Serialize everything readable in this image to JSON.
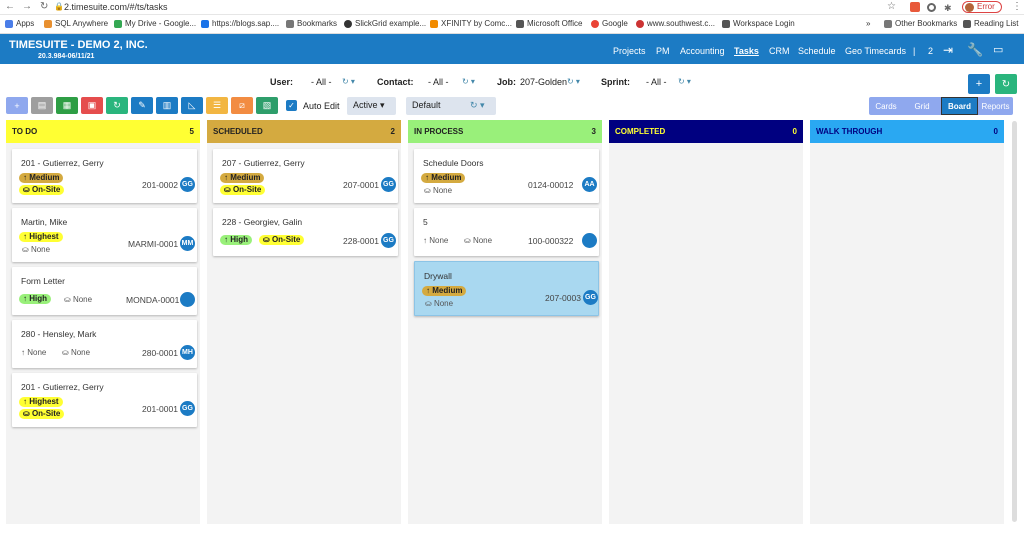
{
  "browser": {
    "url": "2.timesuite.com/#/ts/tasks",
    "error_label": "Error",
    "bookmarks": [
      "Apps",
      "SQL Anywhere",
      "My Drive - Google...",
      "https://blogs.sap....",
      "Bookmarks",
      "SlickGrid example...",
      "XFINITY by Comc...",
      "Microsoft Office",
      "Google",
      "www.southwest.c...",
      "Workspace Login"
    ],
    "other_bookmarks": "Other Bookmarks",
    "reading_list": "Reading List",
    "more": "»"
  },
  "app": {
    "title": "TIMESUITE - DEMO 2, INC.",
    "version": "20.3.984-06/11/21",
    "nav": [
      "Projects",
      "PM",
      "Accounting",
      "Tasks",
      "CRM",
      "Schedule",
      "Geo Timecards"
    ],
    "count": "2",
    "sep": "|"
  },
  "filters": {
    "user_label": "User:",
    "user_value": "- All -",
    "contact_label": "Contact:",
    "contact_value": "- All -",
    "job_label": "Job:",
    "job_value": "207-Golden",
    "sprint_label": "Sprint:",
    "sprint_value": "- All -"
  },
  "toolbar": {
    "auto_edit": "Auto Edit",
    "status_select": "Active",
    "view_select": "Default",
    "views": [
      "Cards",
      "Grid",
      "Board",
      "Reports"
    ],
    "add": "+",
    "refresh": "↻"
  },
  "colors": {
    "accent": "#1c7bc4",
    "todo": "#ffff33",
    "scheduled": "#d4aa40",
    "inprocess": "#99f07a",
    "completed": "#000080",
    "walkthrough": "#2aa8f2"
  },
  "columns": [
    {
      "title": "TO DO",
      "count": "5",
      "cards": [
        {
          "title": "201 - Gutierrez, Gerry",
          "tags": [
            "Medium",
            "On-Site"
          ],
          "num": "201-0002",
          "avatar": "GG"
        },
        {
          "title": "Martin, Mike",
          "tags": [
            "Highest",
            "None"
          ],
          "num": "MARMI-0001",
          "avatar": "MM"
        },
        {
          "title": "Form Letter",
          "tags": [
            "High",
            "None"
          ],
          "num": "MONDA-0001",
          "avatar": ""
        },
        {
          "title": "280 - Hensley, Mark",
          "tags": [
            "None",
            "None"
          ],
          "num": "280-0001",
          "avatar": "MH"
        },
        {
          "title": "201 - Gutierrez, Gerry",
          "tags": [
            "Highest",
            "On-Site"
          ],
          "num": "201-0001",
          "avatar": "GG"
        }
      ]
    },
    {
      "title": "SCHEDULED",
      "count": "2",
      "cards": [
        {
          "title": "207 - Gutierrez, Gerry",
          "tags": [
            "Medium",
            "On-Site"
          ],
          "num": "207-0001",
          "avatar": "GG"
        },
        {
          "title": "228 - Georgiev, Galin",
          "tags": [
            "High",
            "On-Site"
          ],
          "num": "228-0001",
          "avatar": "GG"
        }
      ]
    },
    {
      "title": "IN PROCESS",
      "count": "3",
      "cards": [
        {
          "title": "Schedule Doors",
          "tags": [
            "Medium",
            "None"
          ],
          "num": "0124-00012",
          "avatar": "AA"
        },
        {
          "title": "5",
          "tags": [
            "None",
            "None"
          ],
          "num": "100-000322",
          "avatar": ""
        },
        {
          "title": "Drywall",
          "tags": [
            "Medium",
            "None"
          ],
          "num": "207-0003",
          "avatar": "GG"
        }
      ]
    },
    {
      "title": "COMPLETED",
      "count": "0",
      "cards": []
    },
    {
      "title": "WALK THROUGH",
      "count": "0",
      "cards": []
    }
  ]
}
